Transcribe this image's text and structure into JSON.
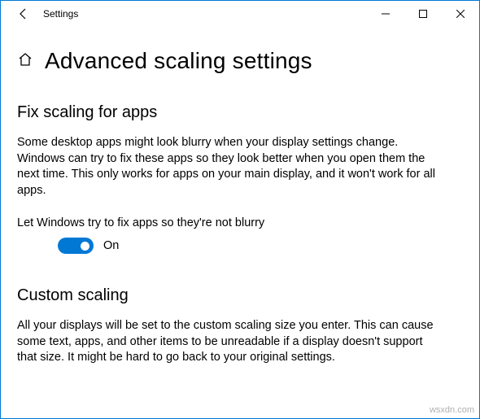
{
  "window": {
    "title": "Settings"
  },
  "header": {
    "page_title": "Advanced scaling settings"
  },
  "section1": {
    "title": "Fix scaling for apps",
    "description": "Some desktop apps might look blurry when your display settings change. Windows can try to fix these apps so they look better when you open them the next time. This only works for apps on your main display, and it won't work for all apps.",
    "toggle_label": "Let Windows try to fix apps so they're not blurry",
    "toggle_state": "On"
  },
  "section2": {
    "title": "Custom scaling",
    "description": "All your displays will be set to the custom scaling size you enter. This can cause some text, apps, and other items to be unreadable if a display doesn't support that size. It might be hard to go back to your original settings."
  },
  "watermark": "wsxdn.com"
}
